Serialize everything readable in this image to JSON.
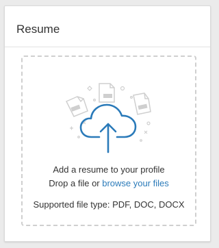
{
  "card": {
    "title": "Resume"
  },
  "dropzone": {
    "headline": "Add a resume to your profile",
    "drop_prefix": "Drop a file or ",
    "browse_link": "browse your files",
    "supported": "Supported file type: PDF, DOC, DOCX"
  },
  "icons": {
    "upload": "cloud-upload-icon",
    "pdf": "file-pdf-icon",
    "doc": "file-doc-icon",
    "docx": "file-docx-icon"
  },
  "colors": {
    "accent": "#2a7ab9",
    "text": "#333333",
    "muted_icon": "#cfcfcf",
    "border": "#cfcfcf"
  }
}
